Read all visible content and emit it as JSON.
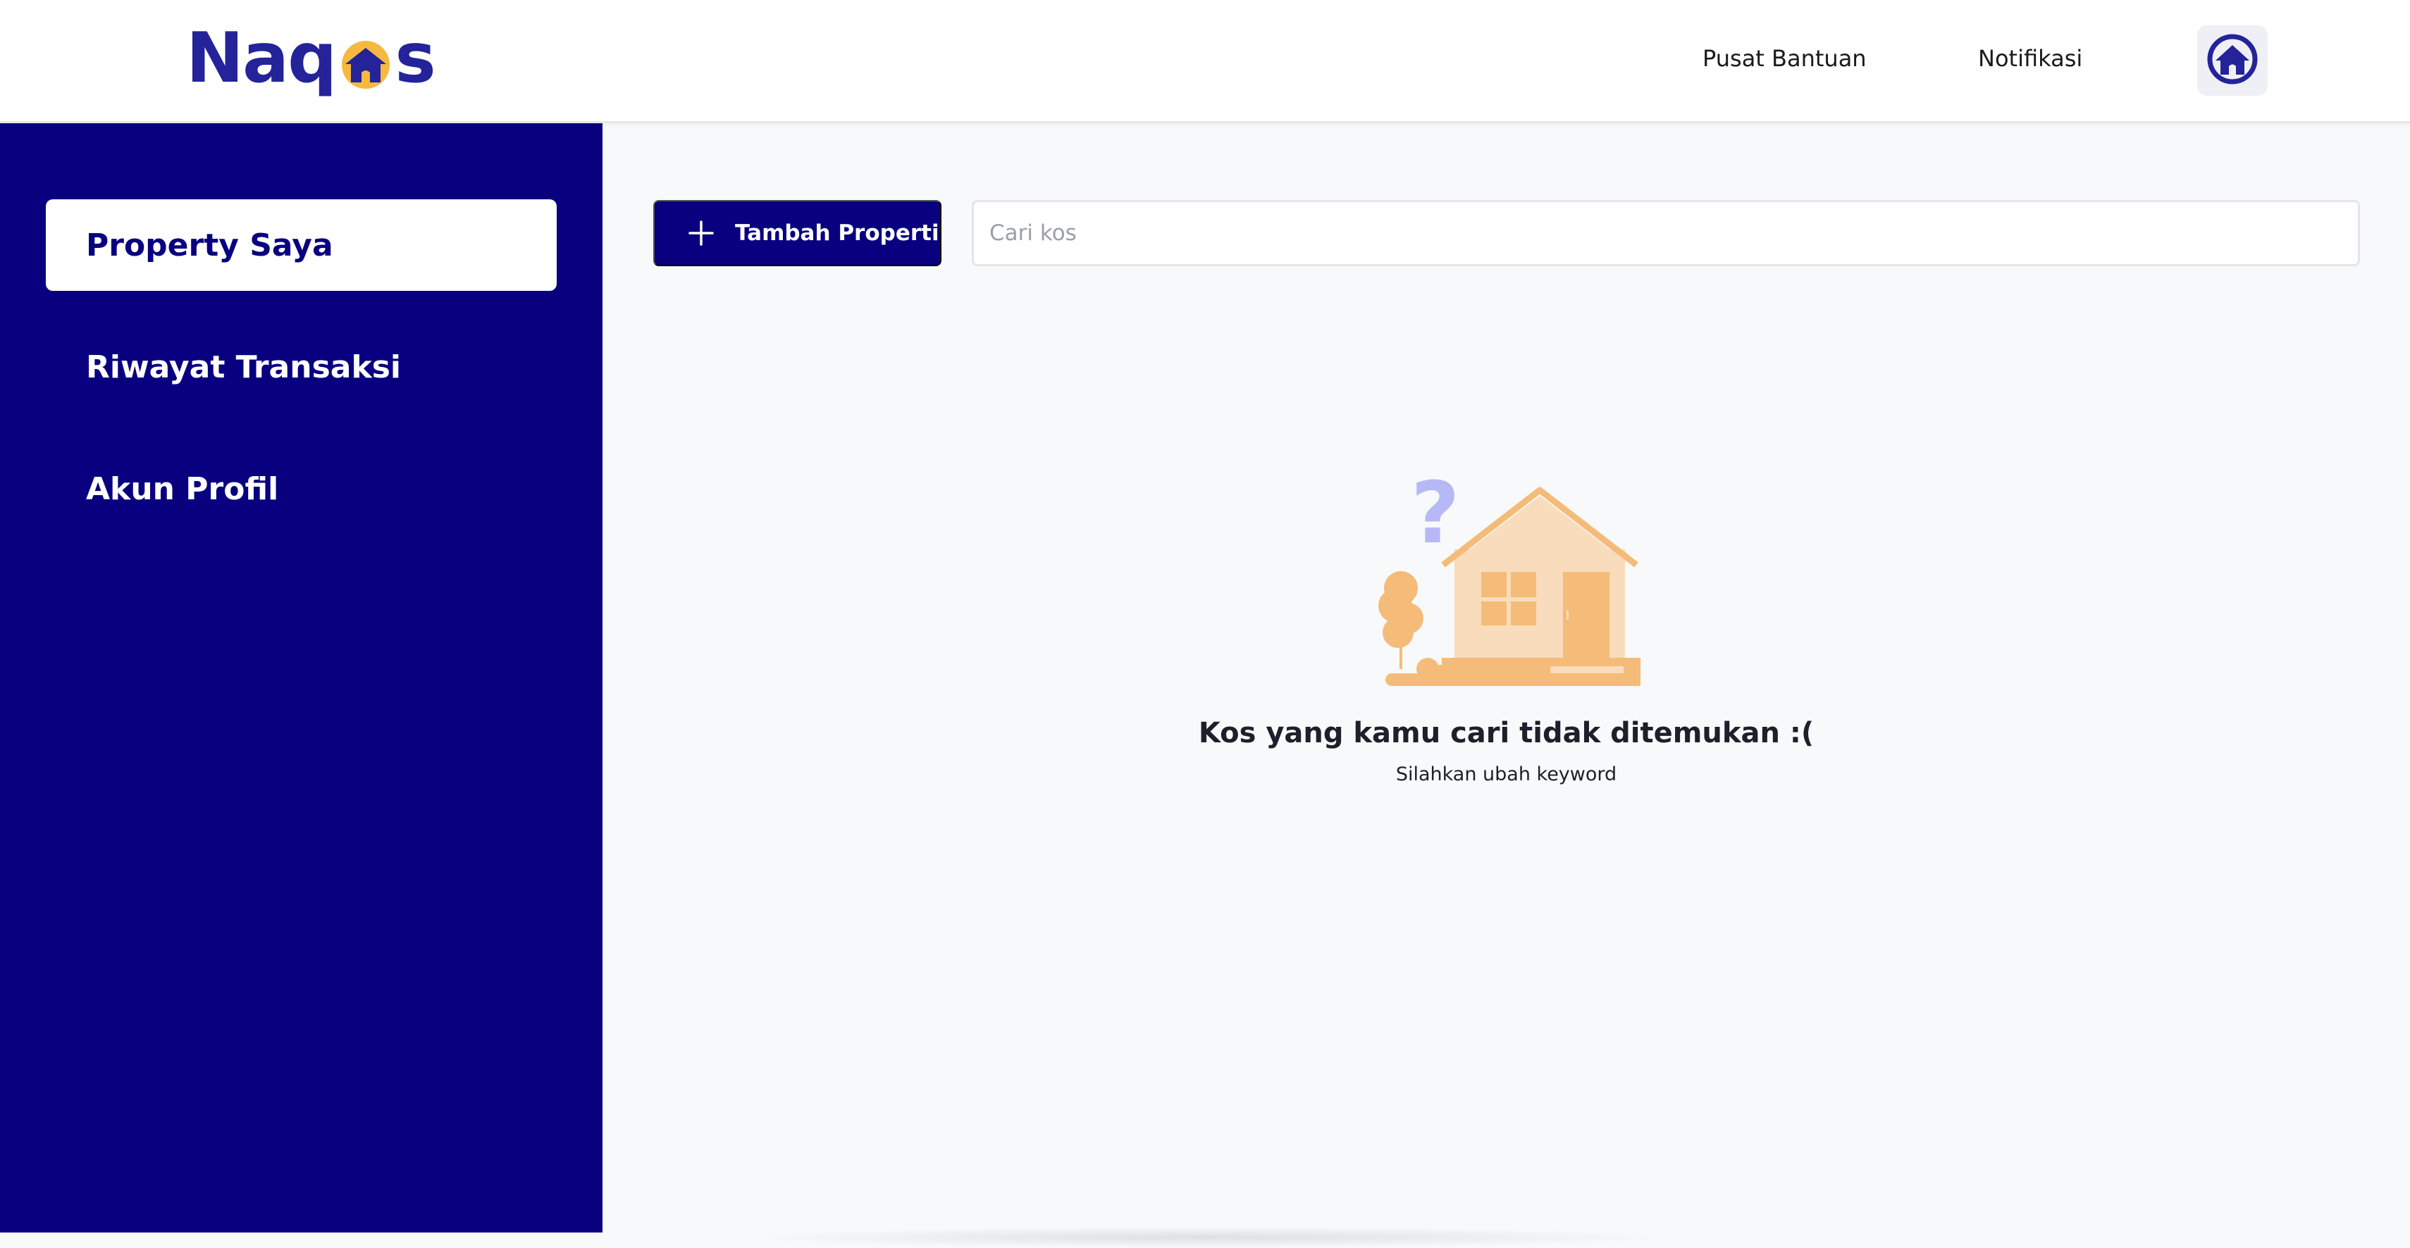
{
  "brand": {
    "name_left": "Naq",
    "name_right": "s",
    "logo_icon": "house-in-circle-icon",
    "primary_color": "#24239a",
    "accent_color": "#f6b93f"
  },
  "header": {
    "help_label": "Pusat Bantuan",
    "notification_label": "Notifikasi",
    "avatar_icon": "home-avatar-icon"
  },
  "sidebar": {
    "background": "#08007f",
    "items": [
      {
        "label": "Property Saya",
        "active": true
      },
      {
        "label": "Riwayat Transaksi",
        "active": false
      },
      {
        "label": "Akun Profil",
        "active": false
      }
    ]
  },
  "toolbar": {
    "add_button_label": "Tambah Properti",
    "add_button_icon": "plus-icon",
    "search_placeholder": "Cari kos",
    "search_value": ""
  },
  "empty_state": {
    "illustration": "house-question-illustration",
    "title": "Kos yang kamu cari tidak ditemukan :(",
    "subtitle": "Silahkan ubah keyword"
  }
}
